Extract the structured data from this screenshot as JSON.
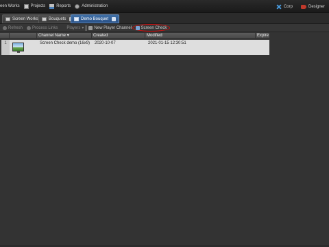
{
  "topbar": {
    "items": [
      {
        "label": "een Works",
        "icon": "screen-works-icon"
      },
      {
        "label": "Projects",
        "icon": "projects-icon"
      },
      {
        "label": "Reports",
        "icon": "reports-icon"
      },
      {
        "label": "Administration",
        "icon": "administration-icon"
      }
    ],
    "right": [
      {
        "label": "Corp",
        "icon": "corp-icon"
      },
      {
        "label": "Designer",
        "icon": "designer-icon"
      }
    ]
  },
  "tabs": [
    {
      "label": "Screen Works",
      "icon": "screen-works-icon",
      "active": false
    },
    {
      "label": "Bouquets",
      "icon": "bouquets-icon",
      "active": false
    },
    {
      "label": "Demo Bouquet",
      "icon": "bouquet-icon",
      "active": true,
      "closable": true
    }
  ],
  "toolbar": {
    "refresh": "Refresh",
    "process_links": "Process Links",
    "players": "Players",
    "players_arrow": "▾",
    "new_player_channel": "New Player Channel",
    "screen_check": "Screen Check"
  },
  "grid": {
    "columns": [
      "",
      "Channel Name",
      "Created",
      "Modified",
      "Expire"
    ],
    "sort_indicator": "▾",
    "rows": [
      {
        "num": "1",
        "channel_name": "Screen Check demo (16x9)",
        "created": "2020-10-07",
        "modified": "2021-01-15 12:30:51",
        "expire": ""
      }
    ]
  },
  "colors": {
    "background": "#333333",
    "active_tab": "#2a5288",
    "highlight_circle": "#d01010",
    "selected_row": "#dedede"
  }
}
